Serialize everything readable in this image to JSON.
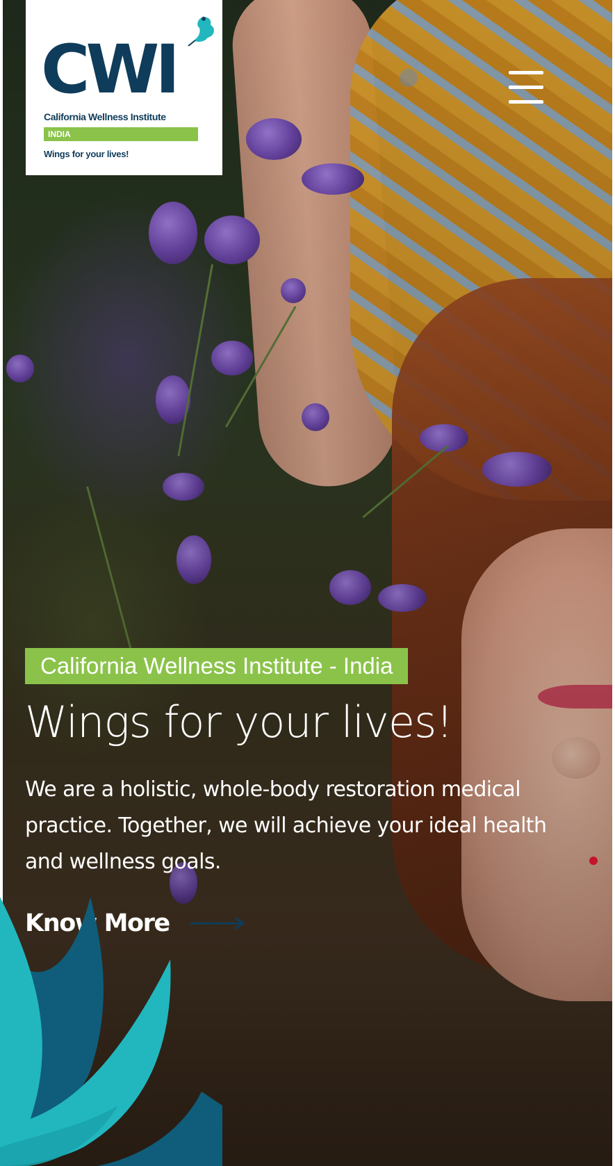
{
  "brand": {
    "logo_text": "CWI",
    "full_name": "California Wellness Institute",
    "region": "INDIA",
    "slogan": "Wings for your lives!",
    "navy": "#0f3c5a",
    "green": "#8bc34a",
    "teal": "#22b7bf"
  },
  "header": {
    "menu_icon": "hamburger-menu-icon"
  },
  "hero": {
    "badge": "California Wellness Institute - India",
    "title": "Wings for your lives!",
    "body": "We are a holistic, whole-body restoration medical practice. Together, we will achieve your ideal health and wellness goals.",
    "cta_label": "Know More",
    "cta_icon": "arrow-right-icon",
    "slider_dot_color": "#c2142a"
  }
}
